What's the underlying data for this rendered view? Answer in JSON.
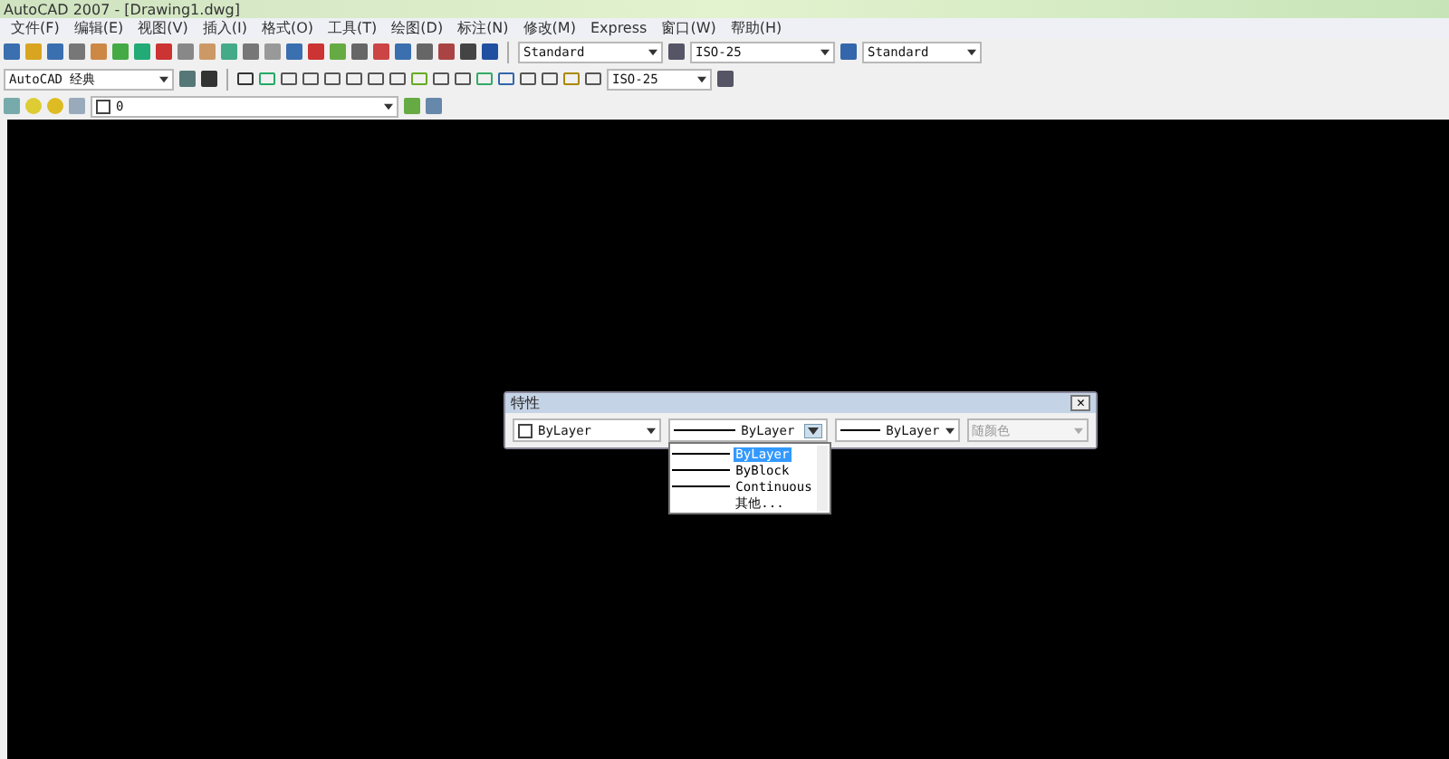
{
  "window": {
    "title": "AutoCAD 2007 - [Drawing1.dwg]"
  },
  "menu": [
    "文件(F)",
    "编辑(E)",
    "视图(V)",
    "插入(I)",
    "格式(O)",
    "工具(T)",
    "绘图(D)",
    "标注(N)",
    "修改(M)",
    "Express",
    "窗口(W)",
    "帮助(H)"
  ],
  "toolbar_1": {
    "text_style": "Standard",
    "dim_style": "ISO-25",
    "table_style": "Standard"
  },
  "toolbar_2": {
    "workspace": "AutoCAD 经典",
    "dim_style": "ISO-25"
  },
  "toolbar_3": {
    "layer": "0"
  },
  "properties_panel": {
    "title": "特性",
    "close": "×",
    "color_setting": "ByLayer",
    "linetype": "ByLayer",
    "lineweight": "ByLayer",
    "plot_style": {
      "value": "随颜色",
      "disabled": true
    },
    "linetype_options": [
      {
        "label": "ByLayer",
        "selected": true
      },
      {
        "label": "ByBlock",
        "selected": false
      },
      {
        "label": "Continuous",
        "selected": false
      },
      {
        "label": "其他...",
        "selected": false
      }
    ]
  }
}
